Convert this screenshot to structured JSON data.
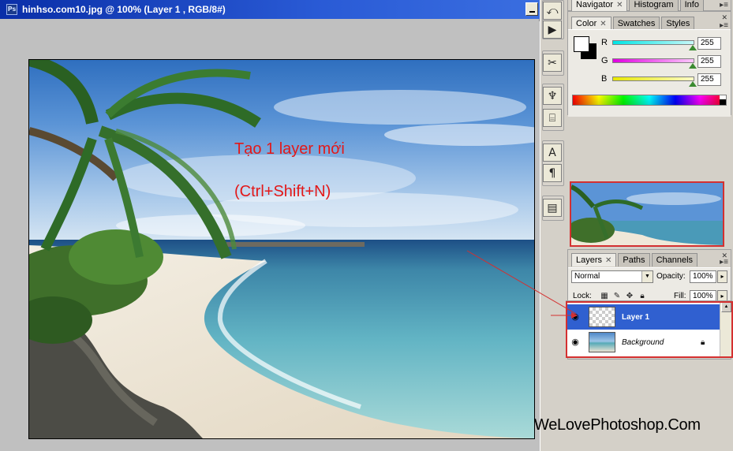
{
  "document": {
    "title": "hinhso.com10.jpg @ 100% (Layer 1 , RGB/8#)",
    "icon": "photoshop-doc-icon"
  },
  "annotations": {
    "line1": "Tạo 1 layer mới",
    "line2": "(Ctrl+Shift+N)",
    "color": "#e31818"
  },
  "tools": {
    "icons": [
      "history-brush-icon",
      "play-action-icon",
      "wand-tool-icon",
      "brush-stamp-icon",
      "clone-stamp-icon",
      "text-A-icon",
      "paragraph-icon",
      "notes-icon"
    ]
  },
  "navigator_panel": {
    "tabs": [
      {
        "label": "Navigator"
      },
      {
        "label": "Histogram"
      },
      {
        "label": "Info"
      }
    ]
  },
  "color_panel": {
    "tabs": [
      {
        "label": "Color"
      },
      {
        "label": "Swatches"
      },
      {
        "label": "Styles"
      }
    ],
    "channels": [
      {
        "label": "R",
        "value": "255",
        "gradient": "#00e5e5"
      },
      {
        "label": "G",
        "value": "255",
        "gradient": "#e000e0"
      },
      {
        "label": "B",
        "value": "255",
        "gradient": "#e8e800"
      }
    ],
    "foreground": "#ffffff",
    "background": "#000000"
  },
  "layers_panel": {
    "tabs": [
      {
        "label": "Layers"
      },
      {
        "label": "Paths"
      },
      {
        "label": "Channels"
      }
    ],
    "blend_mode": "Normal",
    "opacity_label": "Opacity:",
    "opacity_value": "100%",
    "lock_label": "Lock:",
    "fill_label": "Fill:",
    "fill_value": "100%",
    "layers": [
      {
        "name": "Layer 1",
        "selected": true
      },
      {
        "name": "Background",
        "selected": false,
        "locked": true
      }
    ]
  },
  "watermark": "WeLovePhotoshop.Com",
  "highlight_color": "#d43030"
}
